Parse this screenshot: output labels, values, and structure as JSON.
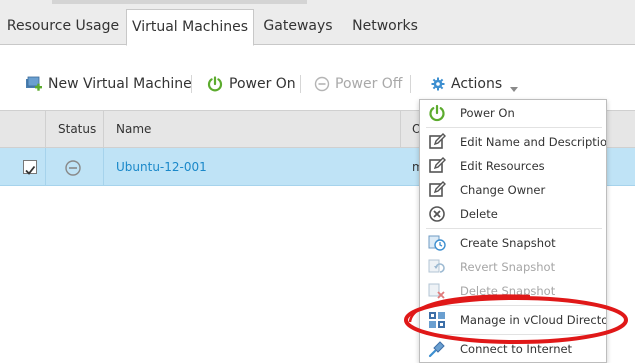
{
  "tabs": [
    {
      "label": "Resource Usage",
      "active": false
    },
    {
      "label": "Virtual Machines",
      "active": true
    },
    {
      "label": "Gateways",
      "active": false
    },
    {
      "label": "Networks",
      "active": false
    }
  ],
  "toolbar": {
    "new_vm": {
      "label": "New Virtual Machine",
      "icon": "new-vm-icon"
    },
    "power_on": {
      "label": "Power On",
      "icon": "power-icon"
    },
    "power_off": {
      "label": "Power Off",
      "icon": "power-off-icon",
      "disabled": true
    },
    "actions": {
      "label": "Actions",
      "icon": "gear-icon"
    }
  },
  "grid": {
    "columns": {
      "status": "Status",
      "name": "Name",
      "owner": "O"
    },
    "rows": [
      {
        "selected": true,
        "status_icon": "minus-circle-icon",
        "name": "Ubuntu-12-001",
        "owner": "m"
      }
    ]
  },
  "menu": {
    "items": [
      {
        "label": "Power On",
        "icon": "power-icon",
        "disabled": false
      },
      {
        "label": "Edit Name and Description",
        "icon": "edit-icon",
        "disabled": false
      },
      {
        "label": "Edit Resources",
        "icon": "edit-icon",
        "disabled": false
      },
      {
        "label": "Change Owner",
        "icon": "edit-icon",
        "disabled": false
      },
      {
        "label": "Delete",
        "icon": "delete-circle-icon",
        "disabled": false
      },
      {
        "label": "Create Snapshot",
        "icon": "snapshot-icon",
        "disabled": false
      },
      {
        "label": "Revert Snapshot",
        "icon": "revert-snapshot-icon",
        "disabled": true
      },
      {
        "label": "Delete Snapshot",
        "icon": "delete-snapshot-icon",
        "disabled": true
      },
      {
        "label": "Manage in vCloud Director",
        "icon": "vcloud-icon",
        "disabled": false
      },
      {
        "label": "Connect to Internet",
        "icon": "connect-icon",
        "disabled": false
      }
    ]
  },
  "colors": {
    "accent_green": "#5cab2e",
    "link_blue": "#1a88c9",
    "selected_row": "#bfe3f6",
    "annotation_red": "#e01818"
  }
}
